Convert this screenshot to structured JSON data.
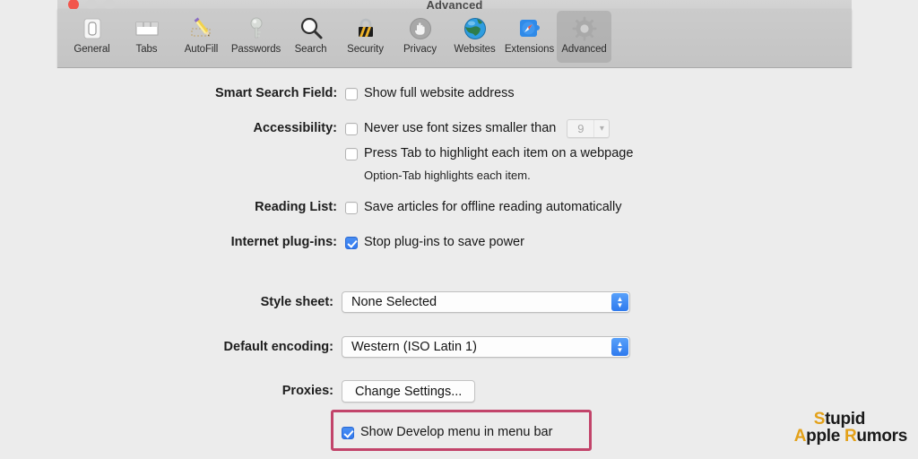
{
  "window": {
    "title": "Advanced",
    "traffic_lights": [
      "close",
      "minimize",
      "zoom"
    ]
  },
  "toolbar": {
    "items": [
      {
        "label": "General",
        "icon": "general-icon",
        "selected": false
      },
      {
        "label": "Tabs",
        "icon": "tabs-icon",
        "selected": false
      },
      {
        "label": "AutoFill",
        "icon": "autofill-icon",
        "selected": false
      },
      {
        "label": "Passwords",
        "icon": "passwords-icon",
        "selected": false
      },
      {
        "label": "Search",
        "icon": "search-icon",
        "selected": false
      },
      {
        "label": "Security",
        "icon": "security-icon",
        "selected": false
      },
      {
        "label": "Privacy",
        "icon": "privacy-icon",
        "selected": false
      },
      {
        "label": "Websites",
        "icon": "websites-icon",
        "selected": false
      },
      {
        "label": "Extensions",
        "icon": "extensions-icon",
        "selected": false
      },
      {
        "label": "Advanced",
        "icon": "advanced-icon",
        "selected": true
      }
    ]
  },
  "form": {
    "smart_search": {
      "label": "Smart Search Field:",
      "checkbox_label": "Show full website address",
      "checked": false
    },
    "accessibility": {
      "label": "Accessibility:",
      "font_size_label": "Never use font sizes smaller than",
      "font_size_checked": false,
      "font_size_value": "9",
      "font_size_disabled": true,
      "tab_highlight_label": "Press Tab to highlight each item on a webpage",
      "tab_highlight_checked": false,
      "hint": "Option-Tab highlights each item."
    },
    "reading_list": {
      "label": "Reading List:",
      "checkbox_label": "Save articles for offline reading automatically",
      "checked": false
    },
    "internet_plugins": {
      "label": "Internet plug-ins:",
      "checkbox_label": "Stop plug-ins to save power",
      "checked": true
    },
    "style_sheet": {
      "label": "Style sheet:",
      "value": "None Selected"
    },
    "default_encoding": {
      "label": "Default encoding:",
      "value": "Western (ISO Latin 1)"
    },
    "proxies": {
      "label": "Proxies:",
      "button_label": "Change Settings..."
    },
    "develop_menu": {
      "checkbox_label": "Show Develop menu in menu bar",
      "checked": true,
      "highlight_color": "#c2446a"
    }
  },
  "watermark": {
    "line1_accent": "S",
    "line1_rest": "tupid",
    "line2_accent_a": "A",
    "line2_mid": "pple ",
    "line2_accent_r": "R",
    "line2_rest": "umors",
    "accent_color": "#e3a11a"
  }
}
